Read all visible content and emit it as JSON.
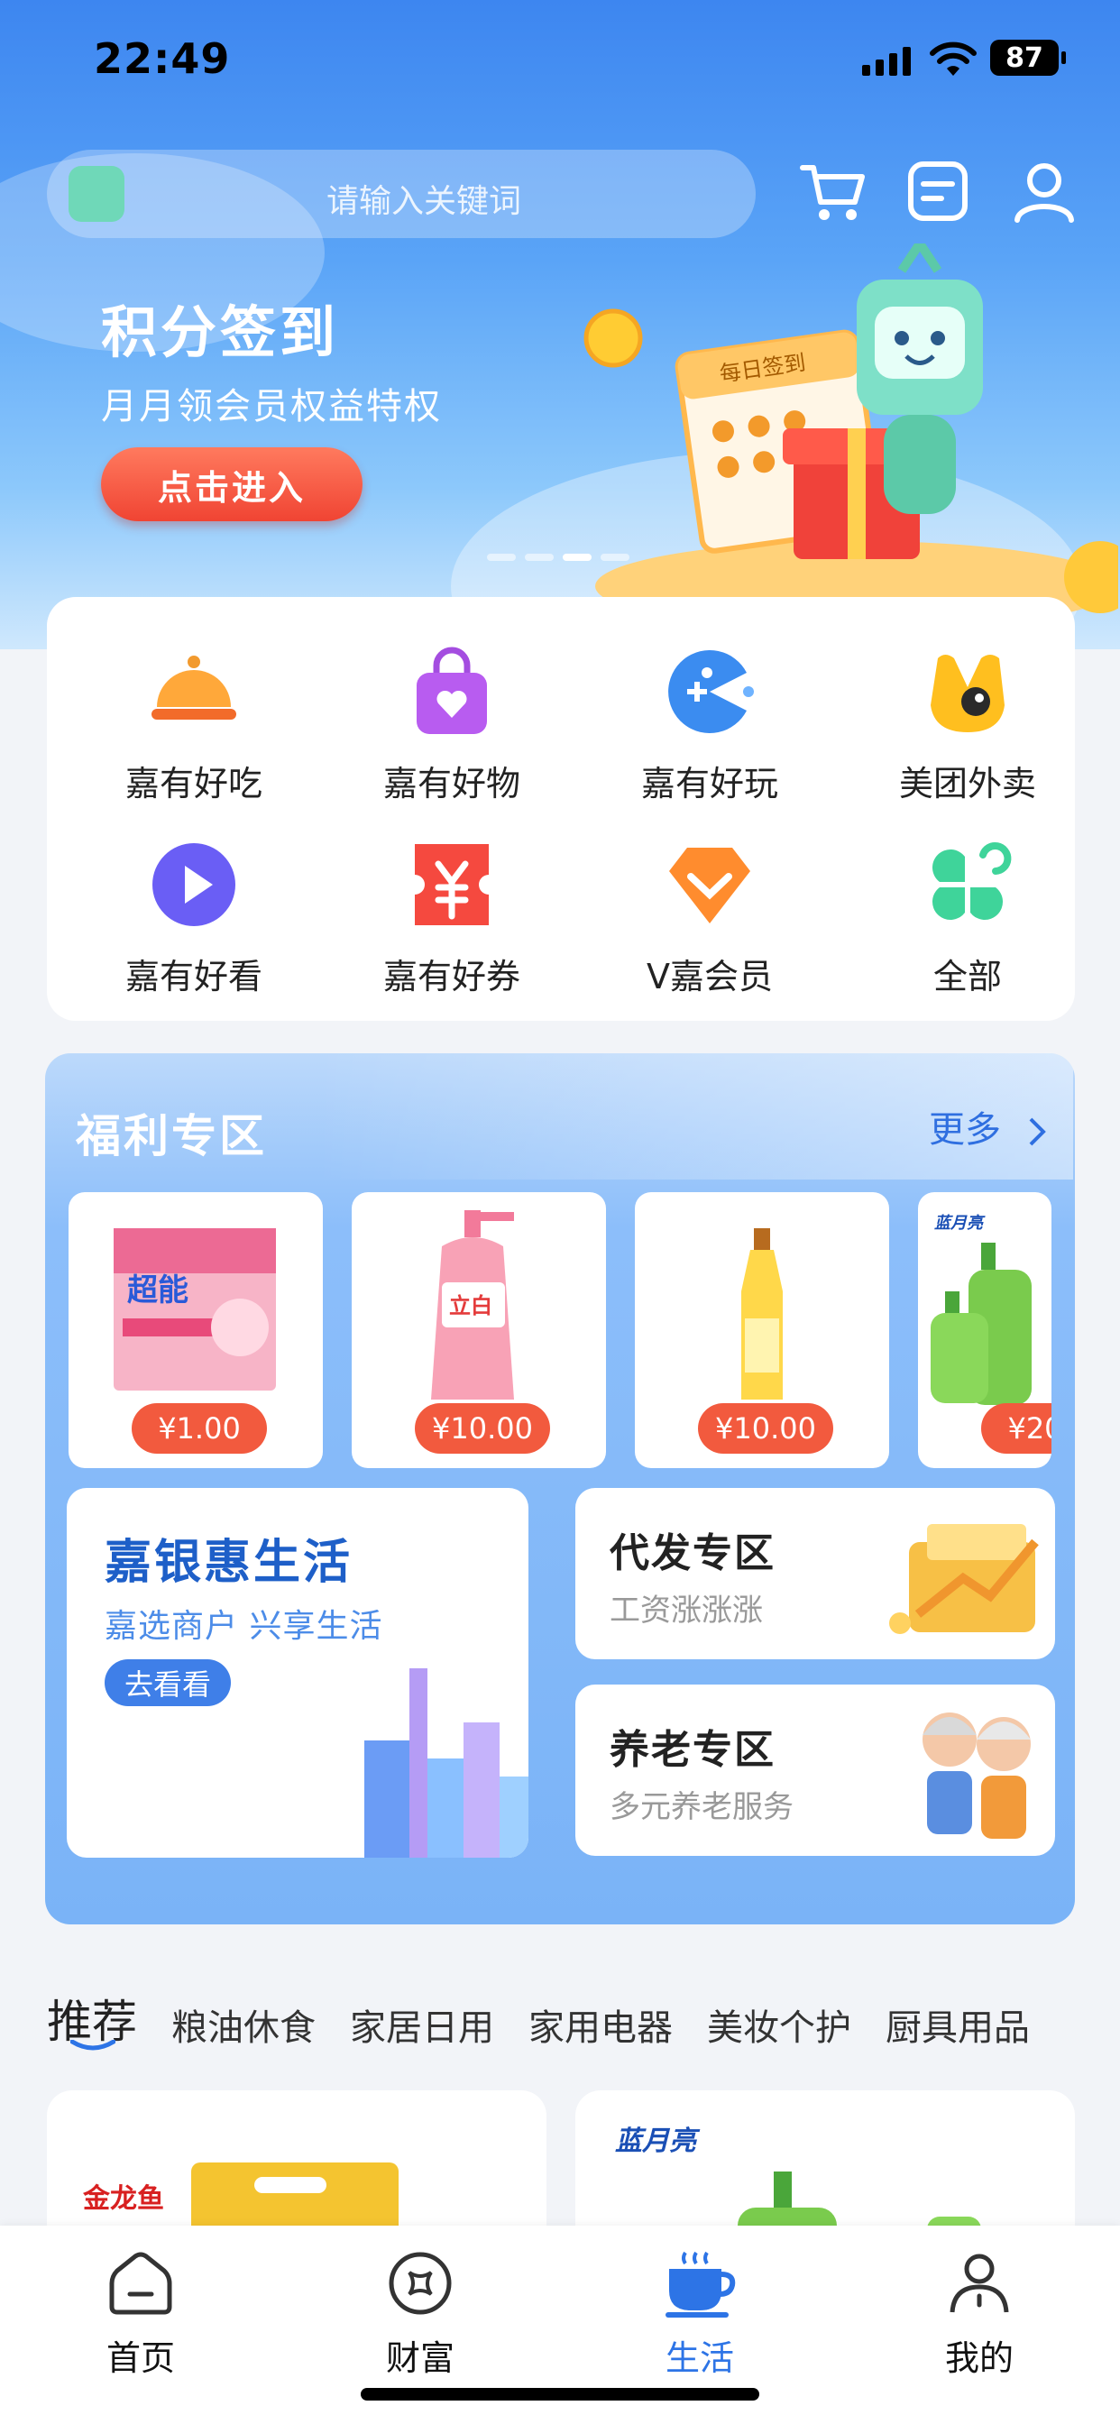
{
  "status": {
    "time": "22:49",
    "battery": "87"
  },
  "search": {
    "placeholder": "请输入关键词"
  },
  "header_icons": [
    "cart-icon",
    "list-icon",
    "user-icon"
  ],
  "banner": {
    "title": "积分签到",
    "subtitle": "月月领会员权益特权",
    "button": "点击进入",
    "calendar_label": "每日签到",
    "active_dot": 3,
    "dot_count": 4
  },
  "menu": {
    "items": [
      {
        "label": "嘉有好吃",
        "icon": "food-cloche-icon"
      },
      {
        "label": "嘉有好物",
        "icon": "shopping-bag-icon"
      },
      {
        "label": "嘉有好玩",
        "icon": "game-pacman-icon"
      },
      {
        "label": "美团外卖",
        "icon": "meituan-icon"
      },
      {
        "label": "嘉有好看",
        "icon": "play-icon"
      },
      {
        "label": "嘉有好券",
        "icon": "coupon-yen-icon"
      },
      {
        "label": "V嘉会员",
        "icon": "diamond-icon"
      },
      {
        "label": "全部",
        "icon": "all-clover-icon"
      }
    ]
  },
  "welfare": {
    "title": "福利专区",
    "more": "更多",
    "products": [
      {
        "price": "¥1.00",
        "image": "soap-box-image",
        "brand": "超能"
      },
      {
        "price": "¥10.00",
        "image": "body-wash-bottle-image",
        "brand": "立白"
      },
      {
        "price": "¥10.00",
        "image": "oil-bottle-image"
      },
      {
        "price": "¥20",
        "image": "hand-wash-bottles-image",
        "brand": "蓝月亮"
      }
    ],
    "big_card": {
      "title": "嘉银惠生活",
      "subtitle": "嘉选商户 兴享生活",
      "button": "去看看"
    },
    "small_cards": [
      {
        "title": "代发专区",
        "subtitle": "工资涨涨涨"
      },
      {
        "title": "养老专区",
        "subtitle": "多元养老服务"
      }
    ]
  },
  "tabs": [
    "推荐",
    "粮油休食",
    "家居日用",
    "家用电器",
    "美妆个护",
    "厨具用品"
  ],
  "feed": [
    {
      "brand": "金龙鱼"
    },
    {
      "brand": "蓝月亮"
    }
  ],
  "nav": {
    "items": [
      {
        "label": "首页",
        "icon": "home-icon"
      },
      {
        "label": "财富",
        "icon": "wealth-icon"
      },
      {
        "label": "生活",
        "icon": "coffee-cup-icon"
      },
      {
        "label": "我的",
        "icon": "profile-icon"
      }
    ],
    "active": 2
  },
  "colors": {
    "primary": "#2d74e6",
    "price": "#f25a3e",
    "banner_button": "#f04433"
  }
}
